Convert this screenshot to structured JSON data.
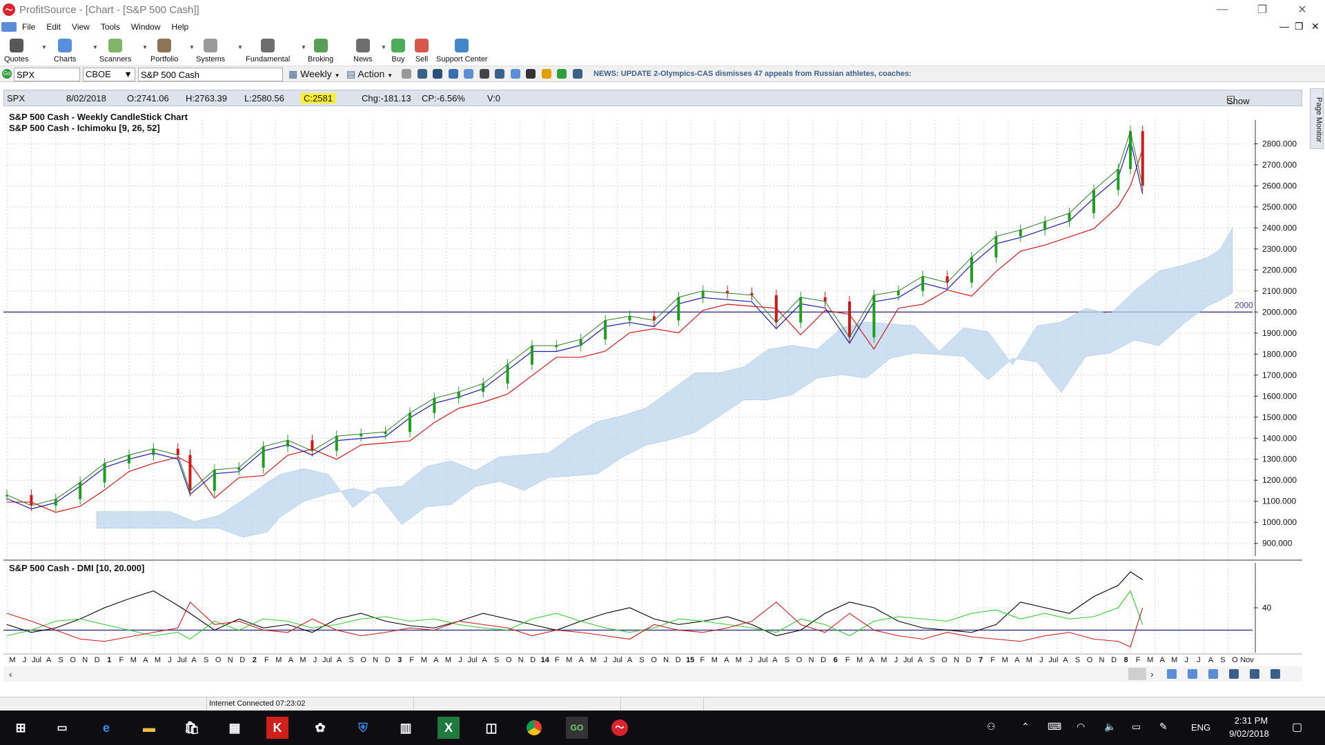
{
  "window": {
    "app_title": "ProfitSource - [Chart -  [S&P 500 Cash]]"
  },
  "menu": [
    "File",
    "Edit",
    "View",
    "Tools",
    "Window",
    "Help"
  ],
  "toolbar": [
    {
      "label": "Quotes",
      "icon": "quotes-icon",
      "color": "#3b3b3b"
    },
    {
      "label": "Charts",
      "icon": "charts-icon",
      "color": "#3a7bd5"
    },
    {
      "label": "Scanners",
      "icon": "scanners-icon",
      "color": "#6aa84f"
    },
    {
      "label": "Portfolio",
      "icon": "portfolio-icon",
      "color": "#7a5a3a"
    },
    {
      "label": "Systems",
      "icon": "systems-icon",
      "color": "#888888"
    },
    {
      "label": "Fundamental",
      "icon": "fundamental-icon",
      "color": "#555555"
    },
    {
      "label": "Broking",
      "icon": "broking-icon",
      "color": "#3b8f3b"
    },
    {
      "label": "News",
      "icon": "news-icon",
      "color": "#555555"
    },
    {
      "label": "Buy",
      "icon": "buy-icon",
      "color": "#2e9e3e"
    },
    {
      "label": "Sell",
      "icon": "sell-icon",
      "color": "#d0392b"
    },
    {
      "label": "Support Center",
      "icon": "support-icon",
      "color": "#1e73be"
    }
  ],
  "symbar": {
    "symbol": "SPX",
    "exchange": "CBOE",
    "name": "S&P 500 Cash",
    "period": "Weekly",
    "action": "Action",
    "news": "NEWS: UPDATE 2-Olympics-CAS dismisses 47 appeals from Russian athletes, coaches:"
  },
  "info": {
    "symbol": "SPX",
    "date": "8/02/2018",
    "open": "O:2741.06",
    "high": "H:2763.39",
    "low": "L:2580.56",
    "close": "C:2581",
    "chg": "Chg:-181.13",
    "cp": "CP:-6.56%",
    "vol": "V:0",
    "show_last": "Show Last"
  },
  "side_tab": "Page Monitor",
  "chart_data": {
    "type": "line",
    "titles": [
      "S&P 500 Cash - Weekly CandleStick Chart",
      "S&P 500 Cash - Ichimoku [9, 26, 52]"
    ],
    "y_ticks": [
      900,
      1000,
      1100,
      1200,
      1300,
      1400,
      1500,
      1600,
      1700,
      1800,
      1900,
      2000,
      2100,
      2200,
      2300,
      2400,
      2500,
      2600,
      2700,
      2800
    ],
    "y_tick_labels": [
      "900.000",
      "1000.000",
      "1100.000",
      "1200.000",
      "1300.000",
      "1400.000",
      "1500.000",
      "1600.000",
      "1700.000",
      "1800.000",
      "1900.000",
      "2000.000",
      "2100.000",
      "2200.000",
      "2300.000",
      "2400.000",
      "2500.000",
      "2600.000",
      "2700.000",
      "2800.000"
    ],
    "ylim": [
      840,
      2880
    ],
    "hline": {
      "value": 2000,
      "label": "2000"
    },
    "date_range": [
      "2010-05",
      "2018-11"
    ],
    "x_labels": [
      "M",
      "J",
      "Jul",
      "A",
      "S",
      "O",
      "N",
      "D",
      "1",
      "F",
      "M",
      "A",
      "M",
      "J",
      "Jul",
      "A",
      "S",
      "O",
      "N",
      "D",
      "2",
      "F",
      "M",
      "A",
      "M",
      "J",
      "Jul",
      "A",
      "S",
      "O",
      "N",
      "D",
      "3",
      "F",
      "M",
      "A",
      "M",
      "J",
      "Jul",
      "A",
      "S",
      "O",
      "N",
      "D",
      "14",
      "F",
      "M",
      "A",
      "M",
      "J",
      "Jul",
      "A",
      "S",
      "O",
      "N",
      "D",
      "15",
      "F",
      "M",
      "A",
      "M",
      "J",
      "Jul",
      "A",
      "S",
      "O",
      "N",
      "D",
      "6",
      "F",
      "M",
      "A",
      "M",
      "J",
      "Jul",
      "A",
      "S",
      "O",
      "N",
      "D",
      "7",
      "F",
      "M",
      "A",
      "M",
      "J",
      "Jul",
      "A",
      "S",
      "O",
      "N",
      "D",
      "8",
      "F",
      "M",
      "A",
      "M",
      "J",
      "J",
      "A",
      "S",
      "O",
      "Nov"
    ],
    "price_series": {
      "name": "Close",
      "dates": [
        "2010-05",
        "2010-07",
        "2010-09",
        "2010-11",
        "2011-01",
        "2011-03",
        "2011-05",
        "2011-07",
        "2011-08",
        "2011-10",
        "2011-12",
        "2012-02",
        "2012-04",
        "2012-06",
        "2012-08",
        "2012-10",
        "2012-12",
        "2013-02",
        "2013-04",
        "2013-06",
        "2013-08",
        "2013-10",
        "2013-12",
        "2014-02",
        "2014-04",
        "2014-06",
        "2014-08",
        "2014-10",
        "2014-12",
        "2015-02",
        "2015-04",
        "2015-06",
        "2015-08",
        "2015-10",
        "2015-12",
        "2016-02",
        "2016-04",
        "2016-06",
        "2016-08",
        "2016-10",
        "2016-12",
        "2017-02",
        "2017-04",
        "2017-06",
        "2017-08",
        "2017-10",
        "2017-12",
        "2018-01",
        "2018-02"
      ],
      "values": [
        1130,
        1080,
        1110,
        1190,
        1280,
        1320,
        1350,
        1320,
        1150,
        1250,
        1260,
        1360,
        1390,
        1340,
        1410,
        1420,
        1430,
        1520,
        1590,
        1620,
        1660,
        1750,
        1840,
        1840,
        1870,
        1960,
        1980,
        1960,
        2070,
        2100,
        2090,
        2080,
        1950,
        2070,
        2050,
        1880,
        2080,
        2100,
        2170,
        2140,
        2260,
        2360,
        2390,
        2430,
        2470,
        2580,
        2680,
        2860,
        2600
      ]
    },
    "indicator": {
      "title": "S&P 500 Cash - DMI [10, 20.000]",
      "y_tick_labels": [
        "40"
      ],
      "ylim": [
        0,
        80
      ],
      "hline": 20,
      "series": [
        {
          "color": "#000000",
          "values": [
            25,
            18,
            22,
            30,
            40,
            48,
            55,
            42,
            35,
            20,
            30,
            22,
            25,
            18,
            30,
            35,
            28,
            24,
            22,
            28,
            35,
            30,
            25,
            20,
            28,
            35,
            40,
            30,
            25,
            28,
            32,
            25,
            15,
            20,
            35,
            45,
            40,
            28,
            22,
            20,
            18,
            25,
            45,
            40,
            35,
            50,
            60,
            72,
            65
          ]
        },
        {
          "color": "#2ecc2e",
          "values": [
            15,
            20,
            28,
            30,
            25,
            20,
            15,
            18,
            12,
            28,
            20,
            30,
            28,
            22,
            25,
            30,
            32,
            28,
            30,
            25,
            22,
            20,
            30,
            35,
            28,
            22,
            18,
            22,
            30,
            28,
            25,
            22,
            18,
            30,
            25,
            15,
            28,
            32,
            30,
            28,
            35,
            38,
            30,
            35,
            30,
            32,
            40,
            55,
            25
          ]
        },
        {
          "color": "#d01818",
          "values": [
            35,
            28,
            20,
            12,
            10,
            14,
            18,
            22,
            45,
            25,
            28,
            20,
            18,
            30,
            20,
            15,
            18,
            22,
            20,
            28,
            25,
            22,
            15,
            20,
            18,
            15,
            12,
            25,
            20,
            18,
            22,
            28,
            45,
            25,
            18,
            35,
            20,
            15,
            12,
            18,
            14,
            12,
            10,
            15,
            18,
            12,
            10,
            5,
            40
          ]
        }
      ]
    }
  },
  "status": {
    "connection": "Internet Connected 07:23:02"
  },
  "taskbar": {
    "lang": "ENG",
    "time": "2:31 PM",
    "date": "9/02/2018"
  }
}
